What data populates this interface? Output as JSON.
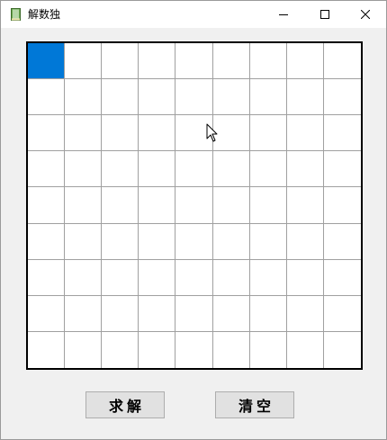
{
  "window": {
    "title": "解数独",
    "icon": "book-icon"
  },
  "window_controls": {
    "minimize_icon": "minimize-icon",
    "maximize_icon": "maximize-icon",
    "close_icon": "close-icon"
  },
  "sudoku": {
    "size": 9,
    "selected_cell": {
      "row": 0,
      "col": 0
    },
    "selected_color": "#0078d7",
    "cells": [
      [
        "",
        "",
        "",
        "",
        "",
        "",
        "",
        "",
        ""
      ],
      [
        "",
        "",
        "",
        "",
        "",
        "",
        "",
        "",
        ""
      ],
      [
        "",
        "",
        "",
        "",
        "",
        "",
        "",
        "",
        ""
      ],
      [
        "",
        "",
        "",
        "",
        "",
        "",
        "",
        "",
        ""
      ],
      [
        "",
        "",
        "",
        "",
        "",
        "",
        "",
        "",
        ""
      ],
      [
        "",
        "",
        "",
        "",
        "",
        "",
        "",
        "",
        ""
      ],
      [
        "",
        "",
        "",
        "",
        "",
        "",
        "",
        "",
        ""
      ],
      [
        "",
        "",
        "",
        "",
        "",
        "",
        "",
        "",
        ""
      ],
      [
        "",
        "",
        "",
        "",
        "",
        "",
        "",
        "",
        ""
      ]
    ]
  },
  "buttons": {
    "solve_label": "求解",
    "clear_label": "清空"
  }
}
